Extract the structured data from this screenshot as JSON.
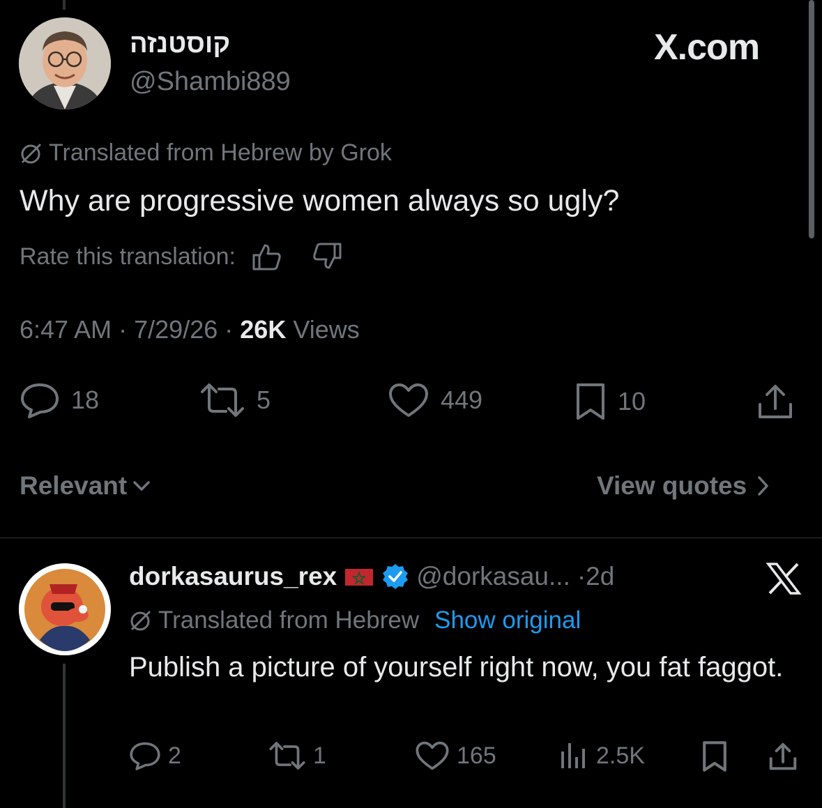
{
  "original_tweet": {
    "display_name": "קוסטנזה",
    "handle": "@Shambi889",
    "watermark": "X.com",
    "translation_note": "Translated from Hebrew by Grok",
    "text": "Why are progressive women always so ugly?",
    "rate_label": "Rate this translation:",
    "time": "6:47 AM",
    "date": "7/29/26",
    "views_count": "26K",
    "views_label": "Views",
    "separator": "·",
    "stats": {
      "replies": "18",
      "reposts": "5",
      "likes": "449",
      "bookmarks": "10"
    }
  },
  "replies_bar": {
    "sort_label": "Relevant",
    "view_quotes": "View quotes"
  },
  "reply": {
    "display_name": "dorkasaurus_rex",
    "handle": "@dorkasau...",
    "age": "·2d",
    "translation_note": "Translated from Hebrew",
    "show_original": "Show original",
    "text": "Publish a picture of yourself right now, you fat faggot.",
    "stats": {
      "replies": "2",
      "reposts": "1",
      "likes": "165",
      "views": "2.5K"
    }
  },
  "colors": {
    "background": "#000000",
    "text": "#e7e9ea",
    "muted": "#71767b",
    "link": "#1d9bf0",
    "verified": "#1d9bf0"
  }
}
